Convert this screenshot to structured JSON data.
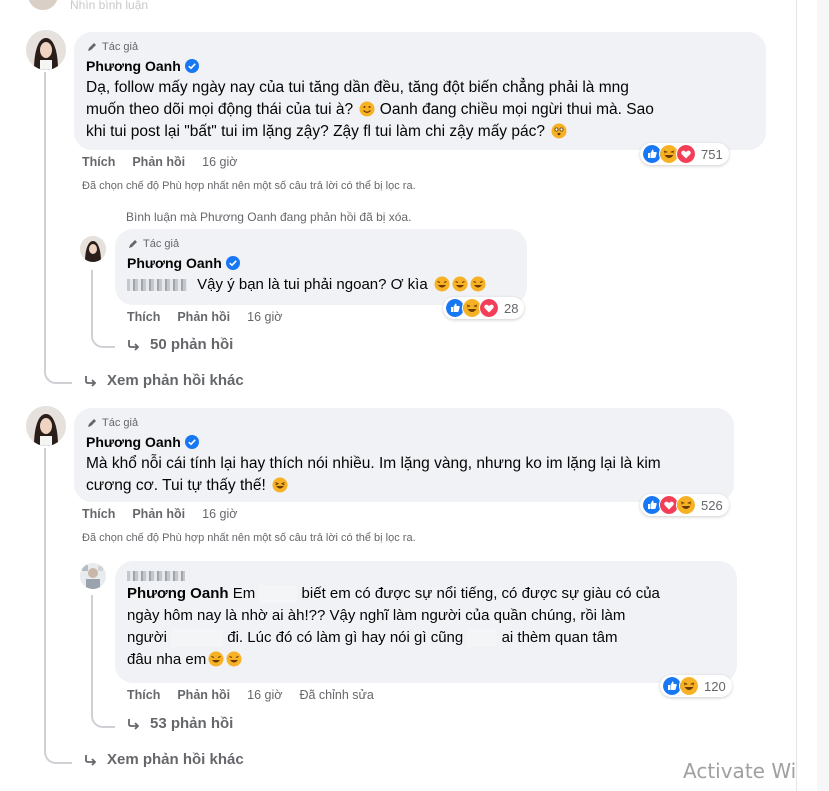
{
  "top_partial": {
    "text": "Nhìn bình luận"
  },
  "colors": {
    "bubble": "#f0f2f5",
    "secondary_text": "#65676b",
    "verified": "#1877f2",
    "like": "#1877f2",
    "love": "#f33e58",
    "haha": "#f7b125"
  },
  "comment1": {
    "author_tag": "Tác giả",
    "author": "Phương Oanh",
    "text_line1": "Dạ, follow mấy ngày nay của tui tăng dần đều, tăng đột biến chẳng phải là mng",
    "text_line2a": "muốn theo dõi mọi động thái của tui à?",
    "text_line2b": "Oanh đang chiều mọi ngừi thui mà. Sao",
    "text_line3": "khi tui post lại \"bất\" tui im lặng zậy? Zậy fl tui làm chi zậy mấy pác?",
    "like": "Thích",
    "reply": "Phản hồi",
    "time": "16 giờ",
    "reaction_count": "751",
    "reaction_icons": [
      "like-icon",
      "haha-icon",
      "love-icon"
    ]
  },
  "filter_note_1": "Đã chọn chế độ Phù hợp nhất nên một số câu trả lời có thể bị lọc ra.",
  "deleted_note": "Bình luận mà Phương Oanh đang phản hồi đã bị xóa.",
  "reply1": {
    "author_tag": "Tác giả",
    "author": "Phương Oanh",
    "text": "Vậy ý bạn là tui phải ngoan? Ơ kìa",
    "like": "Thích",
    "reply": "Phản hồi",
    "time": "16 giờ",
    "reaction_count": "28",
    "reaction_icons": [
      "like-icon",
      "haha-icon",
      "love-icon"
    ],
    "replies_link": "50 phản hồi"
  },
  "more_link_1": "Xem phản hồi khác",
  "comment2": {
    "author_tag": "Tác giả",
    "author": "Phương Oanh",
    "text_line1": "Mà khổ nỗi cái tính lại hay thích nói nhiều. Im lặng vàng, nhưng ko im lặng lại là kim",
    "text_line2": "cương cơ. Tui tự thấy thế!",
    "like": "Thích",
    "reply": "Phản hồi",
    "time": "16 giờ",
    "reaction_count": "526",
    "reaction_icons": [
      "like-icon",
      "love-icon",
      "haha-icon"
    ]
  },
  "filter_note_2": "Đã chọn chế độ Phù hợp nhất nên một số câu trả lời có thể bị lọc ra.",
  "reply2": {
    "mention": "Phương Oanh",
    "text_a": "Em",
    "text_b": "biết em có được sự nổi tiếng, có được sự giàu có của",
    "text_line2": "ngày hôm nay là nhờ ai àh!?? Vậy nghĩ làm người của quần chúng, rồi làm",
    "text_line3a": "người",
    "text_line3b": "đi. Lúc đó có làm gì hay nói gì cũng",
    "text_line3c": "ai thèm quan tâm",
    "text_line4": "đâu nha em",
    "like": "Thích",
    "reply": "Phản hồi",
    "time": "16 giờ",
    "edited": "Đã chỉnh sửa",
    "reaction_count": "120",
    "reaction_icons": [
      "like-icon",
      "haha-icon"
    ],
    "replies_link": "53 phản hồi"
  },
  "more_link_2": "Xem phản hồi khác",
  "watermark": "Activate Wi"
}
